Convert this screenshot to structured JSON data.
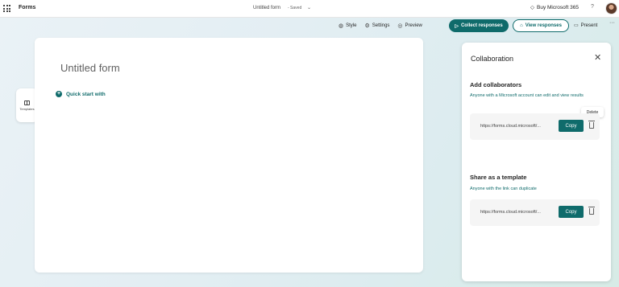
{
  "topbar": {
    "app_name": "Forms",
    "doc_title": "Untitled form",
    "doc_status": "- Saved",
    "buy_label": "Buy Microsoft 365",
    "help_label": "?"
  },
  "toolbar": {
    "style_label": "Style",
    "settings_label": "Settings",
    "preview_label": "Preview",
    "collect_label": "Collect responses",
    "view_label": "View responses",
    "present_label": "Present",
    "more_label": "···"
  },
  "sidebar": {
    "templates_label": "Templates"
  },
  "canvas": {
    "form_title": "Untitled form",
    "quick_start_label": "Quick start with"
  },
  "panel": {
    "title": "Collaboration",
    "add_collab": {
      "title": "Add collaborators",
      "description": "Anyone with a Microsoft account can edit and view results",
      "link": "https://forms.cloud.microsoft/...",
      "copy_label": "Copy",
      "delete_tooltip": "Delete"
    },
    "share_template": {
      "title": "Share as a template",
      "description": "Anyone with the link can duplicate",
      "link": "https://forms.cloud.microsoft/...",
      "copy_label": "Copy"
    }
  },
  "colors": {
    "accent": "#0f6b6b"
  }
}
